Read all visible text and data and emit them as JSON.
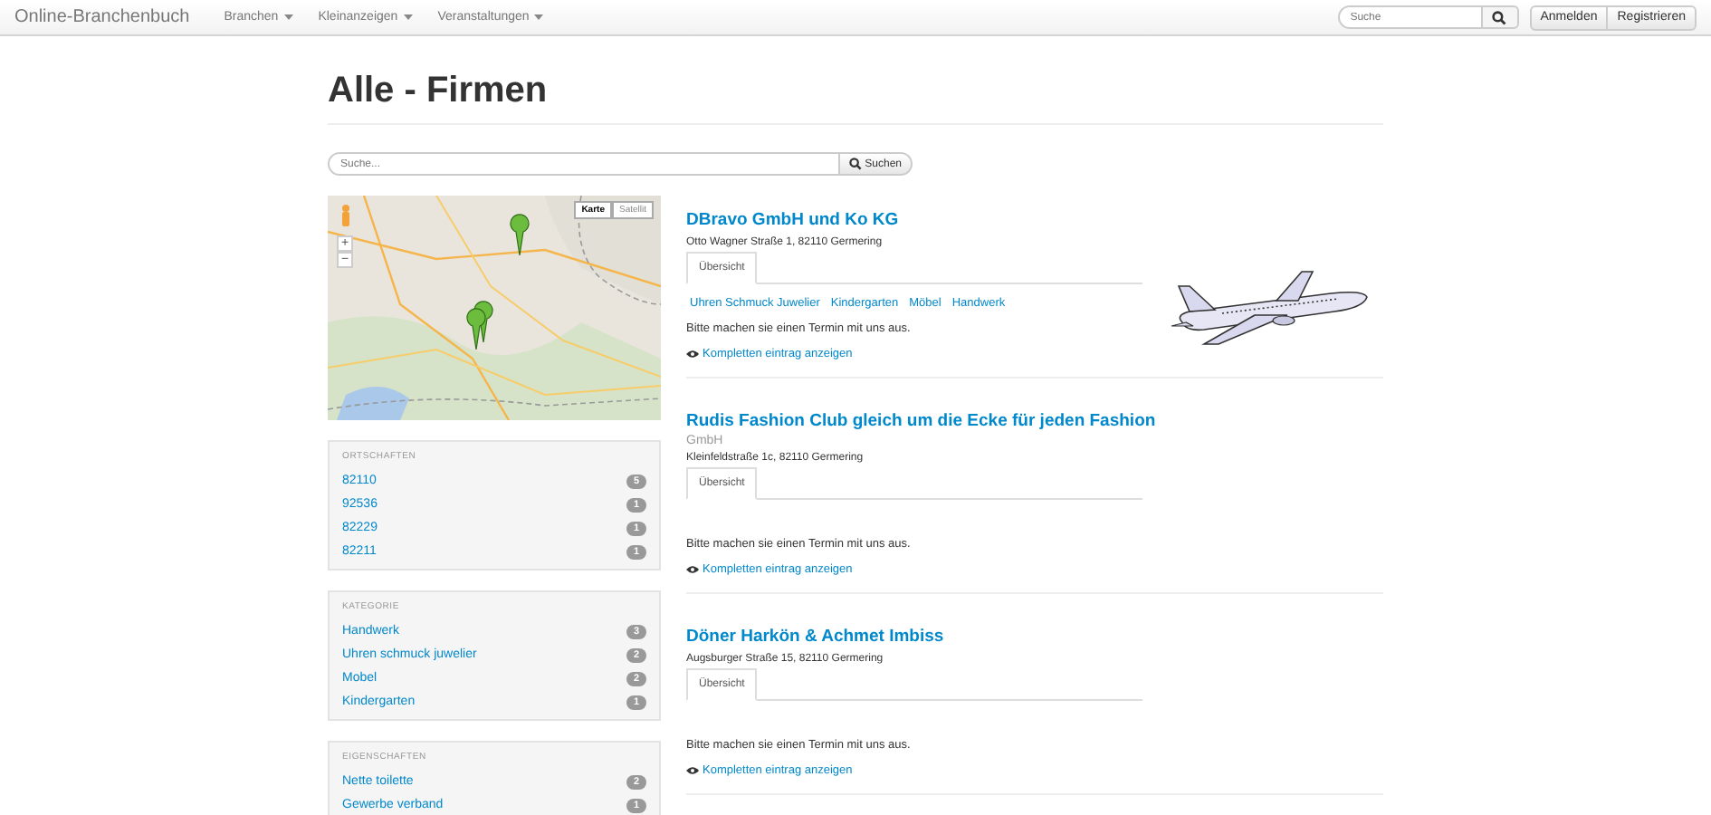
{
  "navbar": {
    "brand": "Online-Branchenbuch",
    "menus": [
      {
        "label": "Branchen"
      },
      {
        "label": "Kleinanzeigen"
      },
      {
        "label": "Veranstaltungen"
      }
    ],
    "search": {
      "placeholder": "Suche"
    },
    "buttons": [
      "Anmelden",
      "Registrieren"
    ]
  },
  "page": {
    "title": "Alle - Firmen",
    "search": {
      "placeholder": "Suche...",
      "button": "Suchen"
    }
  },
  "map": {
    "kind": "picture",
    "map_types": [
      {
        "label": "Karte",
        "selected": true
      },
      {
        "label": "Satellit",
        "selected": false
      }
    ],
    "zoom_in": "+",
    "zoom_out": "−"
  },
  "filters": [
    {
      "heading": "ORTSCHAFTEN",
      "items": [
        {
          "label": "82110",
          "count": "5"
        },
        {
          "label": "92536",
          "count": "1"
        },
        {
          "label": "82229",
          "count": "1"
        },
        {
          "label": "82211",
          "count": "1"
        }
      ]
    },
    {
      "heading": "KATEGORIE",
      "items": [
        {
          "label": "Handwerk",
          "count": "3"
        },
        {
          "label": "Uhren schmuck juwelier",
          "count": "2"
        },
        {
          "label": "Mobel",
          "count": "2"
        },
        {
          "label": "Kindergarten",
          "count": "1"
        }
      ]
    },
    {
      "heading": "EIGENSCHAFTEN",
      "items": [
        {
          "label": "Nette toilette",
          "count": "2"
        },
        {
          "label": "Gewerbe verband",
          "count": "1"
        }
      ]
    }
  ],
  "entries": [
    {
      "name": "DBravo GmbH und Ko KG",
      "address": "Otto Wagner Straße 1, 82110 Germering",
      "tab": {
        "label": "Übersicht",
        "selected": true
      },
      "categories": [
        "Uhren Schmuck Juwelier",
        "Kindergarten",
        "Möbel",
        "Handwerk"
      ],
      "description": "Bitte machen sie einen Termin mit uns aus.",
      "link": "Kompletten eintrag anzeigen"
    },
    {
      "name": "Rudis Fashion Club gleich um die Ecke für jeden Fashion",
      "subtitle": "GmbH",
      "address": "Kleinfeldstraße 1c, 82110 Germering",
      "tab": {
        "label": "Übersicht",
        "selected": true
      },
      "description": "Bitte machen sie einen Termin mit uns aus.",
      "link": "Kompletten eintrag anzeigen"
    },
    {
      "name": "Döner Harkön & Achmet Imbiss",
      "address": "Augsburger Straße 15, 82110 Germering",
      "tab": {
        "label": "Übersicht",
        "selected": true
      },
      "description": "Bitte machen sie einen Termin mit uns aus.",
      "link": "Kompletten eintrag anzeigen"
    }
  ]
}
